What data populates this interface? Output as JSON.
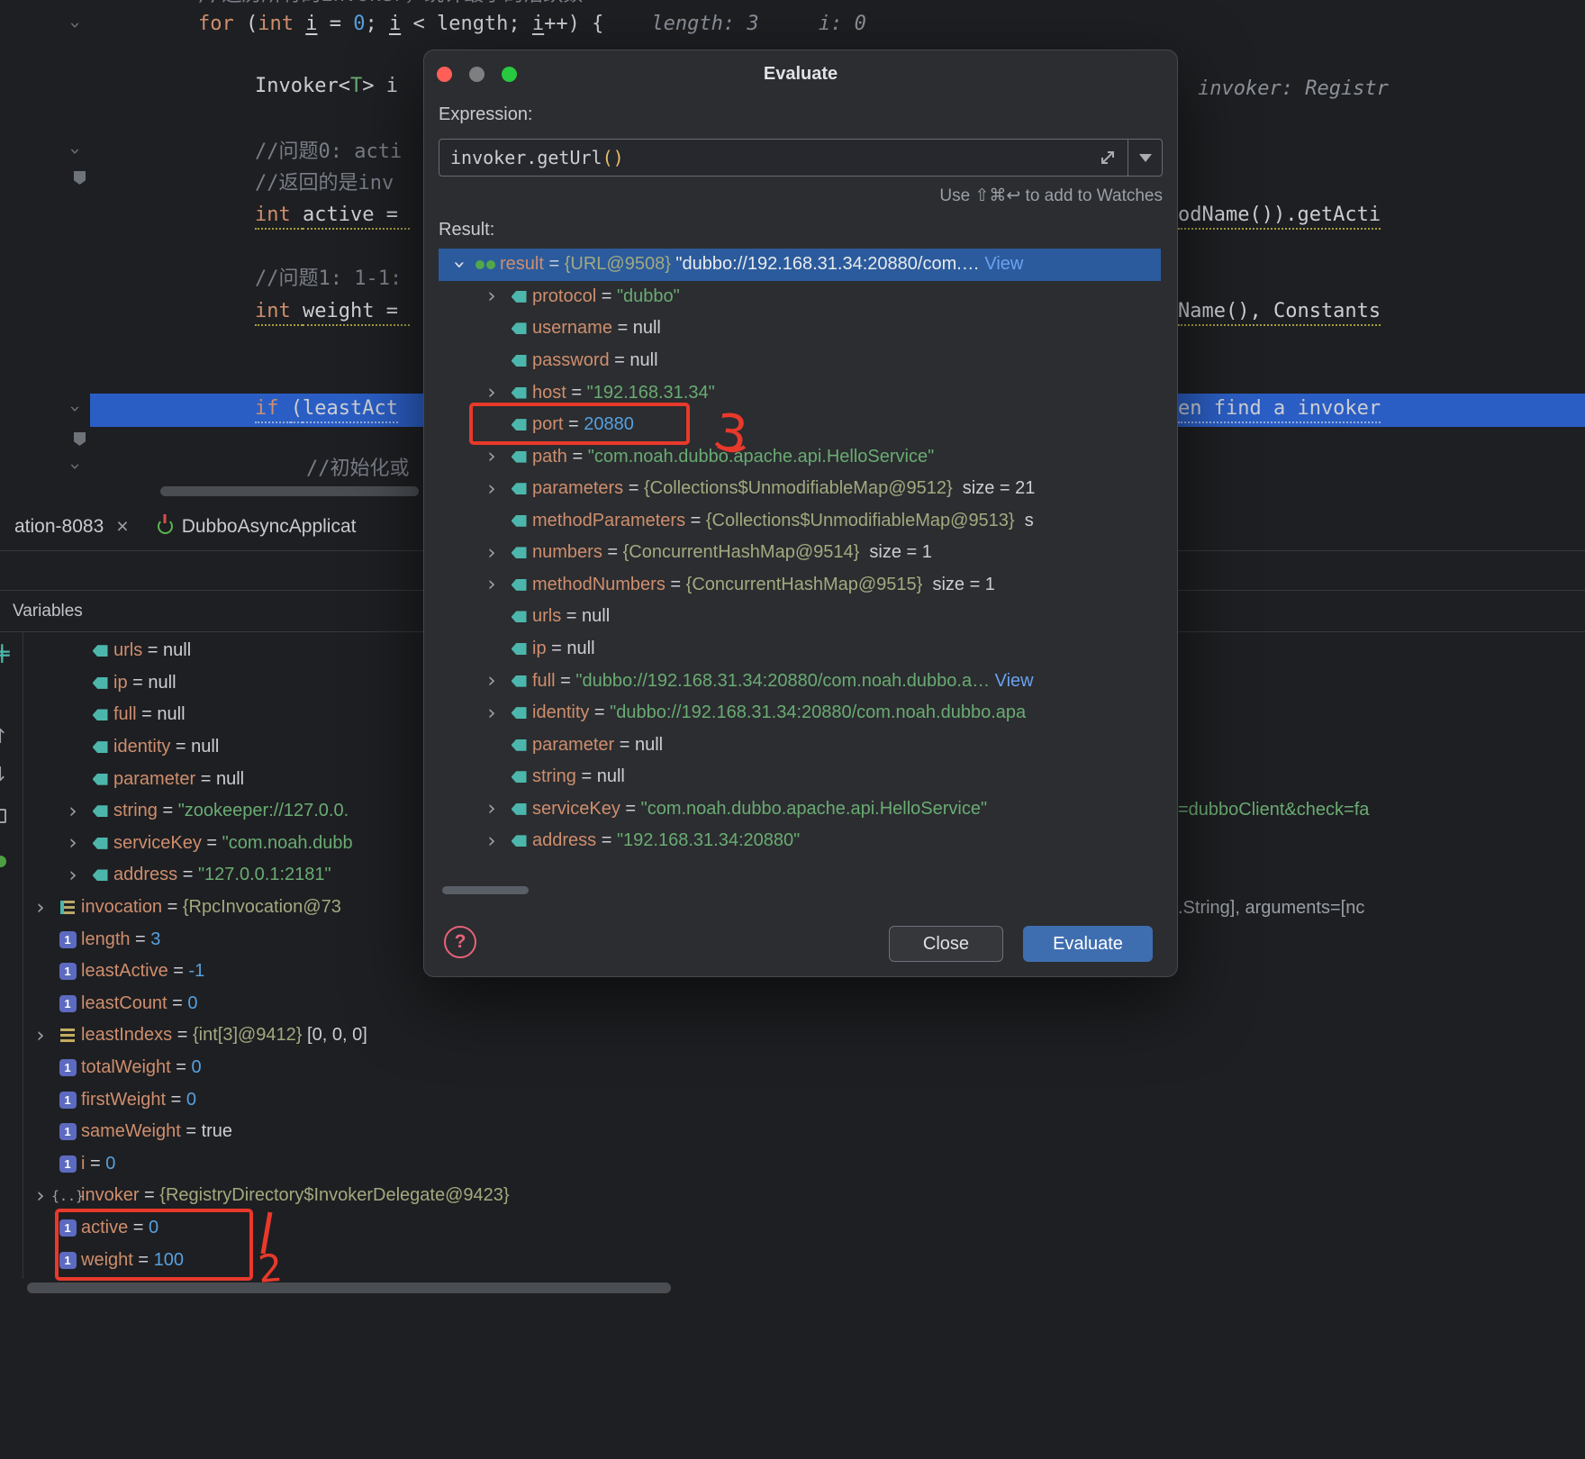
{
  "theme": {
    "background": "#1e1f22",
    "dialog_background": "#2b2d30",
    "selection_blue": "#2b5b9d",
    "execution_line_blue": "#2b5ec4",
    "primary_button_blue": "#3f6eb0",
    "annotation_red": "#e8392b",
    "string_green": "#6aab73",
    "name_orange": "#cf8e6d",
    "number_blue": "#56a0e0",
    "tag_icon_teal": "#4db6ac",
    "traffic_red": "#ff5f57",
    "traffic_gray": "#7e7f80",
    "traffic_green": "#28c840"
  },
  "editor": {
    "top_cut_line_tokens": [
      {
        "t": "//遍历所有的invoker，统计最小的活跃数",
        "c": "comment"
      }
    ],
    "lines": [
      {
        "tokens": [
          {
            "t": "for ",
            "c": "kw"
          },
          {
            "t": "(",
            "c": "plain"
          },
          {
            "t": "int ",
            "c": "kw"
          },
          {
            "t": "i",
            "c": "varu"
          },
          {
            "t": " = ",
            "c": "plain"
          },
          {
            "t": "0",
            "c": "num"
          },
          {
            "t": "; ",
            "c": "plain"
          },
          {
            "t": "i",
            "c": "varu"
          },
          {
            "t": " < length; ",
            "c": "plain"
          },
          {
            "t": "i",
            "c": "varu"
          },
          {
            "t": "++) { ",
            "c": "plain"
          },
          {
            "t": "   length: 3",
            "c": "hint"
          },
          {
            "t": "     i: 0",
            "c": "hint"
          }
        ]
      },
      {
        "tokens": [
          {
            "t": "Invoker",
            "c": "plain"
          },
          {
            "t": "<",
            "c": "plain"
          },
          {
            "t": "T",
            "c": "typ"
          },
          {
            "t": "> i",
            "c": "plain"
          }
        ]
      },
      {
        "tokens": [
          {
            "t": "//问题0: acti",
            "c": "comment"
          }
        ]
      },
      {
        "tokens": [
          {
            "t": "//返回的是inv",
            "c": "comment"
          }
        ]
      },
      {
        "tokens": [
          {
            "t": "int ",
            "c": "kw uy"
          },
          {
            "t": "active = ",
            "c": "plain uy"
          }
        ]
      },
      {
        "tokens": [
          {
            "t": "//问题1: 1-1:",
            "c": "comment"
          }
        ]
      },
      {
        "tokens": [
          {
            "t": "int ",
            "c": "kw uy"
          },
          {
            "t": "weight = ",
            "c": "plain uy"
          }
        ]
      },
      {
        "tokens": [
          {
            "t": "if ",
            "c": "kw uw"
          },
          {
            "t": "(",
            "c": "plain uw"
          },
          {
            "t": "leastAct",
            "c": "plain uw"
          }
        ]
      },
      {
        "tokens": [
          {
            "t": "//初始化或",
            "c": "comment"
          }
        ]
      }
    ],
    "right_fragments": [
      {
        "tokens": [
          {
            "t": "invoker: Registr",
            "c": "hint"
          }
        ]
      },
      {
        "tokens": [
          {
            "t": "odName()).getActi",
            "c": "plain uy"
          }
        ]
      },
      {
        "tokens": [
          {
            "t": "Name(), Constants",
            "c": "plain uy"
          }
        ]
      },
      {
        "tokens": [
          {
            "t": "en find a invoker",
            "c": "plain uw"
          }
        ]
      },
      {
        "tokens": [
          {
            "t": "=dubboClient&check=fa",
            "c": "str"
          }
        ]
      },
      {
        "tokens": [
          {
            "t": ".String], arguments=[nc",
            "c": "dim"
          }
        ]
      }
    ]
  },
  "tabs": [
    {
      "label": "ation-8083"
    },
    {
      "label": "DubboAsyncApplicat"
    }
  ],
  "variables_panel": {
    "header": "Variables",
    "rows": [
      {
        "indent": 1,
        "icon": "tag",
        "name": "urls",
        "parts": [
          {
            "t": " = ",
            "c": "eq"
          },
          {
            "t": "null",
            "c": "plain"
          }
        ]
      },
      {
        "indent": 1,
        "icon": "tag",
        "name": "ip",
        "parts": [
          {
            "t": " = ",
            "c": "eq"
          },
          {
            "t": "null",
            "c": "plain"
          }
        ]
      },
      {
        "indent": 1,
        "icon": "tag",
        "name": "full",
        "parts": [
          {
            "t": " = ",
            "c": "eq"
          },
          {
            "t": "null",
            "c": "plain"
          }
        ]
      },
      {
        "indent": 1,
        "icon": "tag",
        "name": "identity",
        "parts": [
          {
            "t": " = ",
            "c": "eq"
          },
          {
            "t": "null",
            "c": "plain"
          }
        ]
      },
      {
        "indent": 1,
        "icon": "tag",
        "name": "parameter",
        "parts": [
          {
            "t": " = ",
            "c": "eq"
          },
          {
            "t": "null",
            "c": "plain"
          }
        ]
      },
      {
        "indent": 1,
        "chevron": "closed",
        "icon": "tag",
        "name": "string",
        "parts": [
          {
            "t": " = ",
            "c": "eq"
          },
          {
            "t": "\"zookeeper://127.0.0.",
            "c": "str"
          }
        ]
      },
      {
        "indent": 1,
        "chevron": "closed",
        "icon": "tag",
        "name": "serviceKey",
        "parts": [
          {
            "t": " = ",
            "c": "eq"
          },
          {
            "t": "\"com.noah.dubb",
            "c": "str"
          }
        ]
      },
      {
        "indent": 1,
        "chevron": "closed",
        "icon": "tag",
        "name": "address",
        "parts": [
          {
            "t": " = ",
            "c": "eq"
          },
          {
            "t": "\"127.0.0.1:2181\"",
            "c": "str"
          }
        ]
      },
      {
        "indent": 0,
        "chevron": "closed",
        "icon": "params",
        "name": "invocation",
        "parts": [
          {
            "t": " = ",
            "c": "eq"
          },
          {
            "t": "{RpcInvocation@73",
            "c": "ref"
          }
        ]
      },
      {
        "indent": 0,
        "icon": "prim",
        "name": "length",
        "parts": [
          {
            "t": " = ",
            "c": "eq"
          },
          {
            "t": "3",
            "c": "num"
          }
        ]
      },
      {
        "indent": 0,
        "icon": "prim",
        "name": "leastActive",
        "parts": [
          {
            "t": " = ",
            "c": "eq"
          },
          {
            "t": "-1",
            "c": "num"
          }
        ]
      },
      {
        "indent": 0,
        "icon": "prim",
        "name": "leastCount",
        "parts": [
          {
            "t": " = ",
            "c": "eq"
          },
          {
            "t": "0",
            "c": "num"
          }
        ]
      },
      {
        "indent": 0,
        "chevron": "closed",
        "icon": "array",
        "name": "leastIndexs",
        "parts": [
          {
            "t": " = ",
            "c": "eq"
          },
          {
            "t": "{int[3]@9412}",
            "c": "ref"
          },
          {
            "t": " [0, 0, 0]",
            "c": "plain"
          }
        ]
      },
      {
        "indent": 0,
        "icon": "prim",
        "name": "totalWeight",
        "parts": [
          {
            "t": " = ",
            "c": "eq"
          },
          {
            "t": "0",
            "c": "num"
          }
        ]
      },
      {
        "indent": 0,
        "icon": "prim",
        "name": "firstWeight",
        "parts": [
          {
            "t": " = ",
            "c": "eq"
          },
          {
            "t": "0",
            "c": "num"
          }
        ]
      },
      {
        "indent": 0,
        "icon": "prim",
        "name": "sameWeight",
        "parts": [
          {
            "t": " = ",
            "c": "eq"
          },
          {
            "t": "true",
            "c": "plain"
          }
        ]
      },
      {
        "indent": 0,
        "icon": "prim",
        "name": "i",
        "parts": [
          {
            "t": " = ",
            "c": "eq"
          },
          {
            "t": "0",
            "c": "num"
          }
        ]
      },
      {
        "indent": 0,
        "chevron": "closed",
        "icon": "braces",
        "name": "invoker",
        "parts": [
          {
            "t": " = ",
            "c": "eq"
          },
          {
            "t": "{RegistryDirectory$InvokerDelegate@9423}",
            "c": "ref"
          }
        ]
      },
      {
        "indent": 0,
        "icon": "prim",
        "name": "active",
        "parts": [
          {
            "t": " = ",
            "c": "eq"
          },
          {
            "t": "0",
            "c": "num"
          }
        ]
      },
      {
        "indent": 0,
        "icon": "prim",
        "name": "weight",
        "parts": [
          {
            "t": " = ",
            "c": "eq"
          },
          {
            "t": "100",
            "c": "num"
          }
        ]
      }
    ]
  },
  "dialog": {
    "title": "Evaluate",
    "expression_label": "Expression:",
    "expression_tokens": [
      {
        "t": "invoker.getUrl",
        "c": "plain"
      },
      {
        "t": "()",
        "c": "paren"
      }
    ],
    "watches_hint": "Use ⇧⌘↩ to add to Watches",
    "result_label": "Result:",
    "help_label": "?",
    "close_label": "Close",
    "evaluate_label": "Evaluate",
    "rows": [
      {
        "indent": 0,
        "chevron": "open",
        "icon": "glasses",
        "name": "result",
        "selected": true,
        "parts": [
          {
            "t": " = ",
            "c": "eq"
          },
          {
            "t": "{URL@9508}",
            "c": "ref"
          },
          {
            "t": " \"dubbo://192.168.31.34:20880/com.…",
            "c": "strsel"
          },
          {
            "t": " View",
            "c": "link"
          }
        ]
      },
      {
        "indent": 1,
        "chevron": "closed",
        "icon": "tag",
        "name": "protocol",
        "parts": [
          {
            "t": " = ",
            "c": "eq"
          },
          {
            "t": "\"dubbo\"",
            "c": "str"
          }
        ]
      },
      {
        "indent": 1,
        "icon": "tag",
        "name": "username",
        "parts": [
          {
            "t": " = ",
            "c": "eq"
          },
          {
            "t": "null",
            "c": "plain"
          }
        ]
      },
      {
        "indent": 1,
        "icon": "tag",
        "name": "password",
        "parts": [
          {
            "t": " = ",
            "c": "eq"
          },
          {
            "t": "null",
            "c": "plain"
          }
        ]
      },
      {
        "indent": 1,
        "chevron": "closed",
        "icon": "tag",
        "name": "host",
        "parts": [
          {
            "t": " = ",
            "c": "eq"
          },
          {
            "t": "\"192.168.31.34\"",
            "c": "str"
          }
        ]
      },
      {
        "indent": 1,
        "icon": "tag",
        "name": "port",
        "parts": [
          {
            "t": " = ",
            "c": "eq"
          },
          {
            "t": "20880",
            "c": "num"
          }
        ]
      },
      {
        "indent": 1,
        "chevron": "closed",
        "icon": "tag",
        "name": "path",
        "parts": [
          {
            "t": " = ",
            "c": "eq"
          },
          {
            "t": "\"com.noah.dubbo.apache.api.HelloService\"",
            "c": "str"
          }
        ]
      },
      {
        "indent": 1,
        "chevron": "closed",
        "icon": "tag",
        "name": "parameters",
        "parts": [
          {
            "t": " = ",
            "c": "eq"
          },
          {
            "t": "{Collections$UnmodifiableMap@9512}",
            "c": "ref"
          },
          {
            "t": "  size = 21",
            "c": "plain"
          }
        ]
      },
      {
        "indent": 1,
        "icon": "tag",
        "name": "methodParameters",
        "parts": [
          {
            "t": " = ",
            "c": "eq"
          },
          {
            "t": "{Collections$UnmodifiableMap@9513}",
            "c": "ref"
          },
          {
            "t": "  s",
            "c": "plain"
          }
        ]
      },
      {
        "indent": 1,
        "chevron": "closed",
        "icon": "tag",
        "name": "numbers",
        "parts": [
          {
            "t": " = ",
            "c": "eq"
          },
          {
            "t": "{ConcurrentHashMap@9514}",
            "c": "ref"
          },
          {
            "t": "  size = 1",
            "c": "plain"
          }
        ]
      },
      {
        "indent": 1,
        "chevron": "closed",
        "icon": "tag",
        "name": "methodNumbers",
        "parts": [
          {
            "t": " = ",
            "c": "eq"
          },
          {
            "t": "{ConcurrentHashMap@9515}",
            "c": "ref"
          },
          {
            "t": "  size = 1",
            "c": "plain"
          }
        ]
      },
      {
        "indent": 1,
        "icon": "tag",
        "name": "urls",
        "parts": [
          {
            "t": " = ",
            "c": "eq"
          },
          {
            "t": "null",
            "c": "plain"
          }
        ]
      },
      {
        "indent": 1,
        "icon": "tag",
        "name": "ip",
        "parts": [
          {
            "t": " = ",
            "c": "eq"
          },
          {
            "t": "null",
            "c": "plain"
          }
        ]
      },
      {
        "indent": 1,
        "chevron": "closed",
        "icon": "tag",
        "name": "full",
        "parts": [
          {
            "t": " = ",
            "c": "eq"
          },
          {
            "t": "\"dubbo://192.168.31.34:20880/com.noah.dubbo.a…",
            "c": "str"
          },
          {
            "t": " View",
            "c": "link"
          }
        ]
      },
      {
        "indent": 1,
        "chevron": "closed",
        "icon": "tag",
        "name": "identity",
        "parts": [
          {
            "t": " = ",
            "c": "eq"
          },
          {
            "t": "\"dubbo://192.168.31.34:20880/com.noah.dubbo.apa",
            "c": "str"
          }
        ]
      },
      {
        "indent": 1,
        "icon": "tag",
        "name": "parameter",
        "parts": [
          {
            "t": " = ",
            "c": "eq"
          },
          {
            "t": "null",
            "c": "plain"
          }
        ]
      },
      {
        "indent": 1,
        "icon": "tag",
        "name": "string",
        "parts": [
          {
            "t": " = ",
            "c": "eq"
          },
          {
            "t": "null",
            "c": "plain"
          }
        ]
      },
      {
        "indent": 1,
        "chevron": "closed",
        "icon": "tag",
        "name": "serviceKey",
        "parts": [
          {
            "t": " = ",
            "c": "eq"
          },
          {
            "t": "\"com.noah.dubbo.apache.api.HelloService\"",
            "c": "str"
          }
        ]
      },
      {
        "indent": 1,
        "chevron": "closed",
        "icon": "tag",
        "name": "address",
        "parts": [
          {
            "t": " = ",
            "c": "eq"
          },
          {
            "t": "\"192.168.31.34:20880\"",
            "c": "str"
          }
        ]
      }
    ]
  },
  "annotations": {
    "m1": "1",
    "m2": "2",
    "m3": "3"
  }
}
